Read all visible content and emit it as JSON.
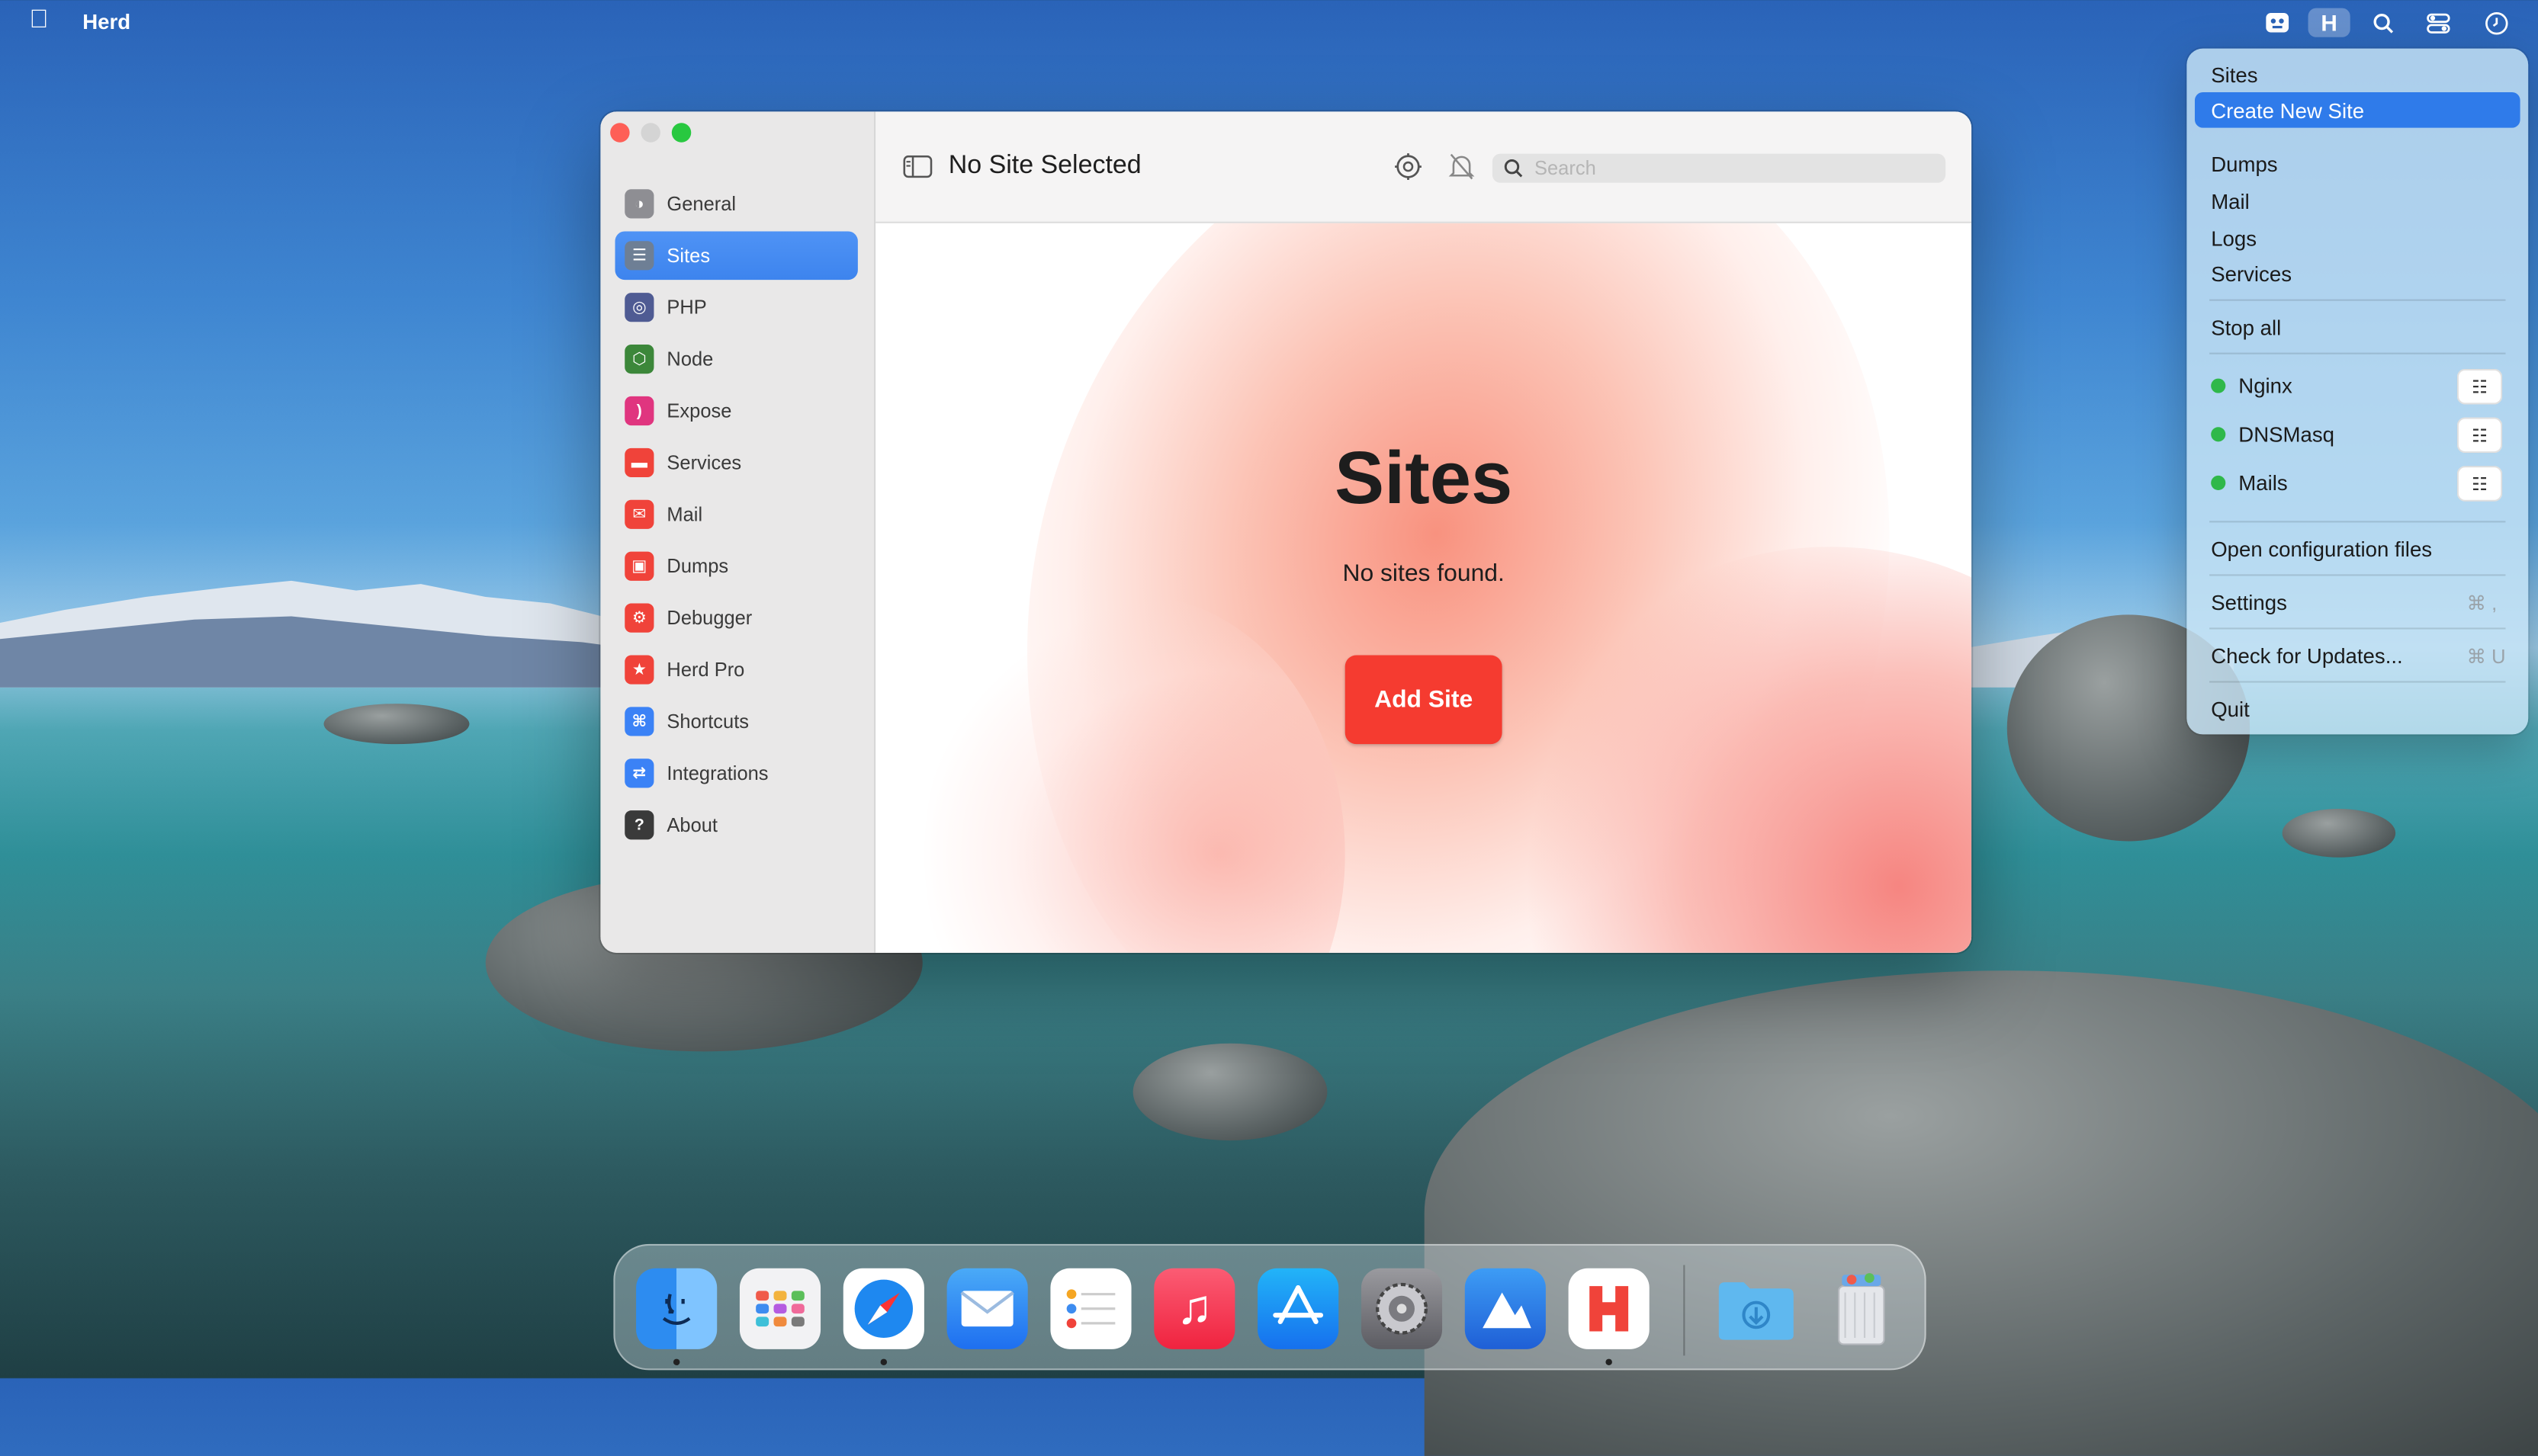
{
  "menubar": {
    "apple_icon": "apple-icon",
    "app_name": "Herd",
    "status_icons": [
      "menubar-app-icon",
      "herd-icon",
      "search-icon",
      "control-center-icon",
      "clock-icon"
    ]
  },
  "window": {
    "toolbar": {
      "title": "No Site Selected",
      "search_placeholder": "Search",
      "icons": [
        "sidebar-toggle-icon",
        "settings-icon",
        "notifications-off-icon",
        "search-icon"
      ]
    },
    "sidebar": {
      "selected": "Sites",
      "items": [
        {
          "label": "General",
          "icon": "general-icon",
          "color": "#8e8e93"
        },
        {
          "label": "Sites",
          "icon": "sites-icon",
          "color": "#6e7f95"
        },
        {
          "label": "PHP",
          "icon": "php-icon",
          "color": "#4f5b93"
        },
        {
          "label": "Node",
          "icon": "node-icon",
          "color": "#3c873a"
        },
        {
          "label": "Expose",
          "icon": "expose-icon",
          "color": "#e0357f"
        },
        {
          "label": "Services",
          "icon": "services-icon",
          "color": "#f0433a"
        },
        {
          "label": "Mail",
          "icon": "mail-icon",
          "color": "#f0433a"
        },
        {
          "label": "Dumps",
          "icon": "dumps-icon",
          "color": "#f0433a"
        },
        {
          "label": "Debugger",
          "icon": "debugger-icon",
          "color": "#f0433a"
        },
        {
          "label": "Herd Pro",
          "icon": "herd-pro-icon",
          "color": "#f0433a"
        },
        {
          "label": "Shortcuts",
          "icon": "shortcuts-icon",
          "color": "#3b82f6"
        },
        {
          "label": "Integrations",
          "icon": "integrations-icon",
          "color": "#3b82f6"
        },
        {
          "label": "About",
          "icon": "about-icon",
          "color": "#3a3a3a"
        }
      ]
    },
    "content": {
      "title": "Sites",
      "subtitle": "No sites found.",
      "add_button": "Add Site"
    }
  },
  "menu": {
    "items": {
      "sites": "Sites",
      "create_new_site": "Create New Site",
      "dumps": "Dumps",
      "mail": "Mail",
      "logs": "Logs",
      "services": "Services",
      "stop_all": "Stop all",
      "open_config": "Open configuration files",
      "settings": "Settings",
      "settings_shortcut": "⌘ ,",
      "check_updates": "Check for Updates...",
      "check_updates_shortcut": "⌘ U",
      "quit": "Quit"
    },
    "services": [
      {
        "name": "Nginx",
        "status": "running"
      },
      {
        "name": "DNSMasq",
        "status": "running"
      },
      {
        "name": "Mails",
        "status": "running"
      }
    ]
  },
  "dock": {
    "apps": [
      "finder-icon",
      "launchpad-icon",
      "safari-icon",
      "mail-icon",
      "reminders-icon",
      "music-icon",
      "app-store-icon",
      "system-settings-icon",
      "affinity-icon",
      "herd-icon",
      "downloads-folder-icon",
      "trash-icon"
    ],
    "running": [
      "finder-icon",
      "safari-icon",
      "herd-icon"
    ]
  },
  "colors": {
    "accent": "#3b82f6",
    "add_button": "#f53b30",
    "status_running": "#2fb84a"
  }
}
